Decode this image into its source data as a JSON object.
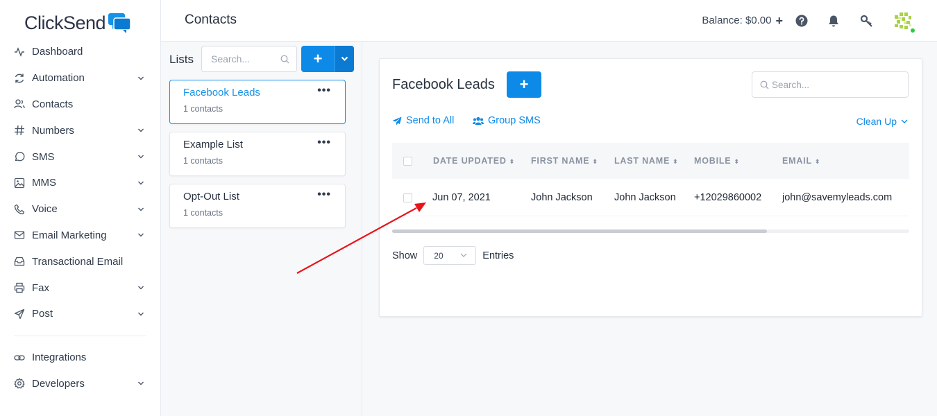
{
  "brand": {
    "logo_text": "ClickSend"
  },
  "sidebar": {
    "items": [
      {
        "label": "Dashboard",
        "icon": "activity-icon",
        "expandable": false
      },
      {
        "label": "Automation",
        "icon": "refresh-icon",
        "expandable": true
      },
      {
        "label": "Contacts",
        "icon": "users-icon",
        "expandable": false
      },
      {
        "label": "Numbers",
        "icon": "hash-icon",
        "expandable": true
      },
      {
        "label": "SMS",
        "icon": "message-circle-icon",
        "expandable": true
      },
      {
        "label": "MMS",
        "icon": "image-icon",
        "expandable": true
      },
      {
        "label": "Voice",
        "icon": "phone-icon",
        "expandable": true
      },
      {
        "label": "Email Marketing",
        "icon": "mail-icon",
        "expandable": true
      },
      {
        "label": "Transactional Email",
        "icon": "inbox-icon",
        "expandable": false
      },
      {
        "label": "Fax",
        "icon": "printer-icon",
        "expandable": true
      },
      {
        "label": "Post",
        "icon": "send-icon",
        "expandable": true
      }
    ],
    "bottom_items": [
      {
        "label": "Integrations",
        "icon": "link-icon",
        "expandable": false
      },
      {
        "label": "Developers",
        "icon": "settings-icon",
        "expandable": true
      }
    ]
  },
  "header": {
    "title": "Contacts",
    "balance": "Balance: $0.00",
    "balance_add": "+"
  },
  "lists_panel": {
    "title": "Lists",
    "search_placeholder": "Search...",
    "add_label": "+",
    "lists": [
      {
        "name": "Facebook Leads",
        "count": "1 contacts",
        "active": true
      },
      {
        "name": "Example List",
        "count": "1 contacts",
        "active": false
      },
      {
        "name": "Opt-Out List",
        "count": "1 contacts",
        "active": false
      }
    ],
    "more_label": "•••"
  },
  "main": {
    "title": "Facebook Leads",
    "add_label": "+",
    "search_placeholder": "Search...",
    "send_to_all": "Send to All",
    "group_sms": "Group SMS",
    "clean_up": "Clean Up",
    "columns": [
      "DATE UPDATED",
      "FIRST NAME",
      "LAST NAME",
      "MOBILE",
      "EMAIL"
    ],
    "rows": [
      {
        "date_updated": "Jun 07, 2021",
        "first_name": "John Jackson",
        "last_name": "John Jackson",
        "mobile": "+12029860002",
        "email": "john@savemyleads.com"
      }
    ],
    "show_label": "Show",
    "entries_value": "20",
    "entries_label": "Entries"
  },
  "colors": {
    "accent": "#0d8ae8",
    "annotation_arrow": "#e8141b",
    "online_dot": "#2ecc40"
  }
}
